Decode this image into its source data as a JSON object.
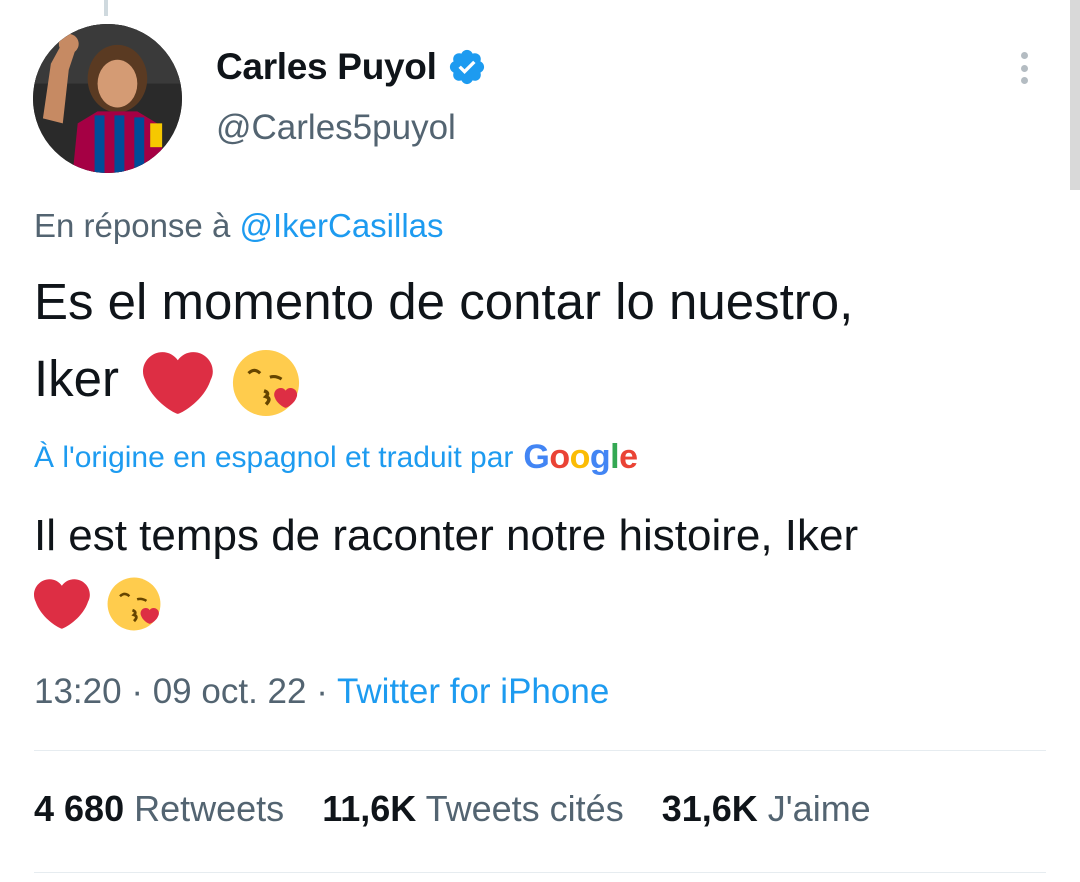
{
  "author": {
    "name": "Carles Puyol",
    "handle": "@Carles5puyol",
    "verified": true
  },
  "reply": {
    "prefix": "En réponse à",
    "mention": "@IkerCasillas"
  },
  "tweet": {
    "line1": "Es el momento de contar lo nuestro,",
    "line2": "Iker",
    "emojis": [
      "red-heart-icon",
      "face-blowing-kiss-icon"
    ]
  },
  "translation_notice": {
    "text": "À l'origine en espagnol et traduit par",
    "provider": [
      "G",
      "o",
      "o",
      "g",
      "l",
      "e"
    ]
  },
  "translated_text": "Il est temps de raconter notre histoire, Iker",
  "meta": {
    "time": "13:20",
    "sep1": "·",
    "date": "09 oct. 22",
    "sep2": "·",
    "source": "Twitter for iPhone"
  },
  "stats": [
    {
      "count": "4 680",
      "label": "Retweets"
    },
    {
      "count": "11,6K",
      "label": "Tweets cités"
    },
    {
      "count": "31,6K",
      "label": "J'aime"
    }
  ],
  "colors": {
    "accent": "#1d9bf0",
    "secondary_text": "#536471",
    "heart": "#e0243a"
  }
}
